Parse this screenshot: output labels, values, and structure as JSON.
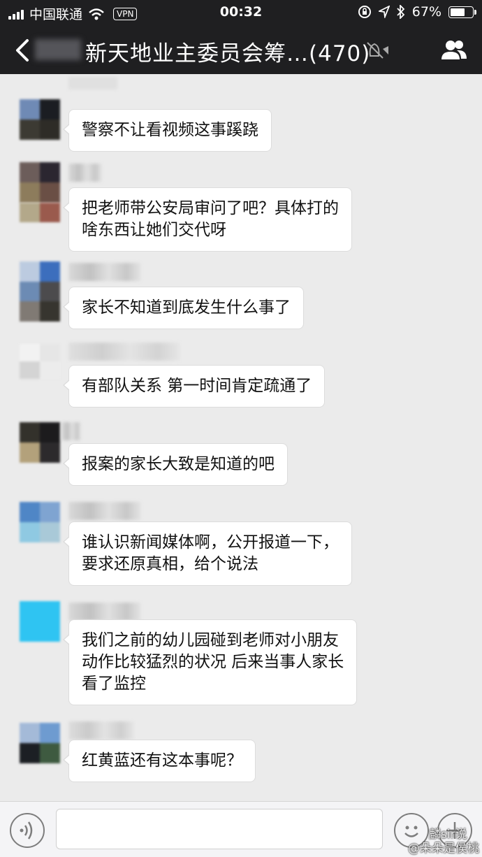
{
  "status_bar": {
    "carrier": "中国联通",
    "vpn": "VPN",
    "time": "00:32",
    "battery": "67%",
    "battery_level": 0.67
  },
  "header": {
    "title": "新天地业主委员会筹…(470)"
  },
  "messages": [
    {
      "lines": [
        "警察不让看视频这事蹊跷"
      ]
    },
    {
      "lines": [
        "把老师带公安局审问了吧？具体打的",
        "啥东西让她们交代呀"
      ]
    },
    {
      "lines": [
        "家长不知道到底发生什么事了"
      ]
    },
    {
      "lines": [
        "有部队关系 第一时间肯定疏通了"
      ]
    },
    {
      "lines": [
        "报案的家长大致是知道的吧"
      ]
    },
    {
      "lines": [
        "谁认识新闻媒体啊，公开报道一下，",
        "要求还原真相，给个说法"
      ]
    },
    {
      "lines": [
        "我们之前的幼儿园碰到老师对小朋友",
        "动作比较猛烈的状况 后来当事人家长",
        "看了监控"
      ]
    },
    {
      "lines": [
        "红黄蓝还有这本事呢？"
      ]
    }
  ],
  "watermark": {
    "line1": "麟sir说",
    "line2": "@朵朵是侯桃"
  }
}
